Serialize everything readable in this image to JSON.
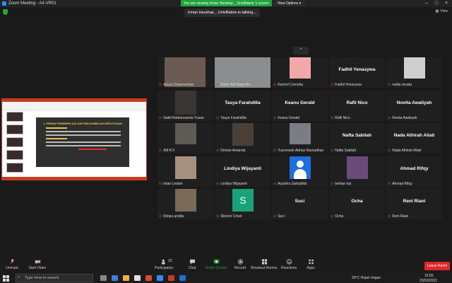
{
  "window": {
    "title": "Zoom Meeting - A4-VR01"
  },
  "view_banner": {
    "text": "You are viewing Irman Harahap _ UnivBakrie 's screen",
    "options_label": "View Options"
  },
  "talking": "Irman Harahap _ UnivBakrie is talking...",
  "grid_label": "View",
  "share": {
    "slide_title": "1. PERAN PEMIMPIN DALAM PENGAMBILAN KEPUTUSAN"
  },
  "participants": [
    {
      "name": "Azura Chaerunnisa",
      "big": ""
    },
    {
      "name": "Satrio Adi Nugroho",
      "big": ""
    },
    {
      "name": "Rachel Cornelia",
      "big": ""
    },
    {
      "name": "Fadhil Yenasywa",
      "big": "Fadhil Yenasywa"
    },
    {
      "name": "nadia renata",
      "big": ""
    },
    {
      "name": "Nabil Raihannanda Yuzan",
      "big": ""
    },
    {
      "name": "Tasya Farahdilla",
      "big": "Tasya Farahdilla"
    },
    {
      "name": "Keanu Gerald",
      "big": "Keanu Gerald"
    },
    {
      "name": "Rafli Nico",
      "big": "Rafli Nico"
    },
    {
      "name": "Novita Awaliyah",
      "big": "Novita Awaliyah"
    },
    {
      "name": "Alif R.F",
      "big": ""
    },
    {
      "name": "Denise Amanda",
      "big": ""
    },
    {
      "name": "Yusronsah Adrian Ramadhan",
      "big": ""
    },
    {
      "name": "Nafta Sabilah",
      "big": "Nafta Sabilah"
    },
    {
      "name": "Nada Athirah Aliati",
      "big": "Nada Athirah Aliati"
    },
    {
      "name": "intan Lestari",
      "big": ""
    },
    {
      "name": "Lindiya Wijayanti",
      "big": "Lindiya Wijayanti"
    },
    {
      "name": "Azzahra Salsabilla",
      "big": ""
    },
    {
      "name": "berlian tvp",
      "big": ""
    },
    {
      "name": "Ahmad Rifqy",
      "big": "Ahmad Rifqy"
    },
    {
      "name": "Rizqia andita",
      "big": ""
    },
    {
      "name": "Sheren Crisel",
      "big": ""
    },
    {
      "name": "Suci",
      "big": "Suci"
    },
    {
      "name": "Ocha",
      "big": "Ocha"
    },
    {
      "name": "Reni Riani",
      "big": "Reni Riani"
    }
  ],
  "toolbar": {
    "unmute": "Unmute",
    "start_video": "Start Video",
    "participants": "Participants",
    "participants_count": "26",
    "chat": "Chat",
    "share_screen": "Share Screen",
    "record": "Record",
    "breakout": "Breakout Rooms",
    "reactions": "Reactions",
    "apps": "Apps",
    "leave": "Leave Room"
  },
  "taskbar": {
    "search_placeholder": "Type here to search",
    "weather": "29°C  Hujan ringan",
    "time": "15:55",
    "date": "23/03/2022"
  },
  "colors": {
    "accent_green": "#22a33b",
    "leave_red": "#e02828",
    "share_border": "#cc3333"
  }
}
